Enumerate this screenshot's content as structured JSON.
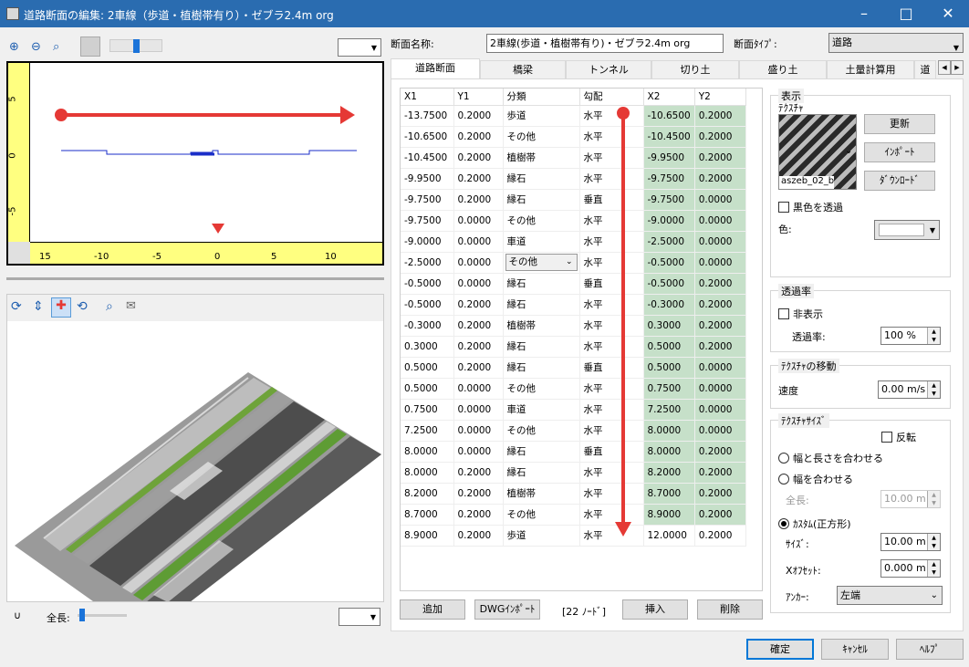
{
  "window": {
    "title": "道路断面の編集: 2車線（歩道・植樹帯有り）・ゼブラ2.4m org"
  },
  "profile": {
    "y_ticks": [
      "5",
      "0",
      "-5"
    ],
    "x_ticks": [
      "15",
      "-10",
      "-5",
      "0",
      "5",
      "10"
    ]
  },
  "fields": {
    "section_name_label": "断面名称:",
    "section_name_value": "2車線(歩道・植樹帯有り)・ゼブラ2.4m org",
    "section_type_label": "断面ﾀｲﾌﾟ:",
    "section_type_value": "道路"
  },
  "tabs": [
    "道路断面",
    "橋梁",
    "トンネル",
    "切り土",
    "盛り土",
    "土量計算用",
    "道"
  ],
  "table": {
    "headers": [
      "X1",
      "Y1",
      "分類",
      "勾配",
      "X2",
      "Y2"
    ],
    "rows": [
      [
        "-13.7500",
        "0.2000",
        "歩道",
        "水平",
        "-10.6500",
        "0.2000"
      ],
      [
        "-10.6500",
        "0.2000",
        "その他",
        "水平",
        "-10.4500",
        "0.2000"
      ],
      [
        "-10.4500",
        "0.2000",
        "植樹帯",
        "水平",
        "-9.9500",
        "0.2000"
      ],
      [
        "-9.9500",
        "0.2000",
        "縁石",
        "水平",
        "-9.7500",
        "0.2000"
      ],
      [
        "-9.7500",
        "0.2000",
        "縁石",
        "垂直",
        "-9.7500",
        "0.0000"
      ],
      [
        "-9.7500",
        "0.0000",
        "その他",
        "水平",
        "-9.0000",
        "0.0000"
      ],
      [
        "-9.0000",
        "0.0000",
        "車道",
        "水平",
        "-2.5000",
        "0.0000"
      ],
      [
        "-2.5000",
        "0.0000",
        "その他",
        "水平",
        "-0.5000",
        "0.0000"
      ],
      [
        "-0.5000",
        "0.0000",
        "縁石",
        "垂直",
        "-0.5000",
        "0.2000"
      ],
      [
        "-0.5000",
        "0.2000",
        "縁石",
        "水平",
        "-0.3000",
        "0.2000"
      ],
      [
        "-0.3000",
        "0.2000",
        "植樹帯",
        "水平",
        "0.3000",
        "0.2000"
      ],
      [
        "0.3000",
        "0.2000",
        "縁石",
        "水平",
        "0.5000",
        "0.2000"
      ],
      [
        "0.5000",
        "0.2000",
        "縁石",
        "垂直",
        "0.5000",
        "0.0000"
      ],
      [
        "0.5000",
        "0.0000",
        "その他",
        "水平",
        "0.7500",
        "0.0000"
      ],
      [
        "0.7500",
        "0.0000",
        "車道",
        "水平",
        "7.2500",
        "0.0000"
      ],
      [
        "7.2500",
        "0.0000",
        "その他",
        "水平",
        "8.0000",
        "0.0000"
      ],
      [
        "8.0000",
        "0.0000",
        "縁石",
        "垂直",
        "8.0000",
        "0.2000"
      ],
      [
        "8.0000",
        "0.2000",
        "縁石",
        "水平",
        "8.2000",
        "0.2000"
      ],
      [
        "8.2000",
        "0.2000",
        "植樹帯",
        "水平",
        "8.7000",
        "0.2000"
      ],
      [
        "8.7000",
        "0.2000",
        "その他",
        "水平",
        "8.9000",
        "0.2000"
      ],
      [
        "8.9000",
        "0.2000",
        "歩道",
        "水平",
        "12.0000",
        "0.2000"
      ]
    ]
  },
  "bottom_buttons": {
    "add": "追加",
    "dwg_import": "DWGｲﾝﾎﾟｰﾄ",
    "node_count": "[22 ﾉｰﾄﾞ]",
    "insert": "挿入",
    "delete": "削除"
  },
  "display": {
    "group_label": "表示",
    "texture_label": "ﾃｸｽﾁｬ",
    "texture_name": "aszeb_02_b",
    "update_button": "更新",
    "import_button": "ｲﾝﾎﾟｰﾄ",
    "download_button": "ﾀﾞｳﾝﾛｰﾄﾞ",
    "transparent_black_label": "黒色を透過",
    "color_label": "色:"
  },
  "transparency": {
    "group_label": "透過率",
    "hide_label": "非表示",
    "rate_label": "透過率:",
    "rate_value": "100 %"
  },
  "texture_move": {
    "group_label": "ﾃｸｽﾁｬの移動",
    "speed_label": "速度",
    "speed_value": "0.00 m/s"
  },
  "texture_size": {
    "group_label": "ﾃｸｽﾁｬｻｲｽﾞ",
    "flip_label": "反転",
    "fit_both_label": "幅と長さを合わせる",
    "fit_width_label": "幅を合わせる",
    "total_length_label": "全長:",
    "total_length_value": "10.00 m",
    "custom_label": "ｶｽﾀﾑ(正方形)",
    "size_label": "ｻｲｽﾞ:",
    "size_value": "10.00 m",
    "x_offset_label": "Xｵﾌｾｯﾄ:",
    "x_offset_value": "0.000 m",
    "anchor_label": "ｱﾝｶｰ:",
    "anchor_value": "左端"
  },
  "left_bottom": {
    "total_length_label": "全長:"
  },
  "dialog_buttons": {
    "ok": "確定",
    "cancel": "ｷｬﾝｾﾙ",
    "help": "ﾍﾙﾌﾟ"
  },
  "colors": {
    "titlebar": "#2a6cb0",
    "grid_green": "#c6e0c9",
    "ruler_yellow": "#ffff80",
    "arrow_red": "#e53935"
  }
}
